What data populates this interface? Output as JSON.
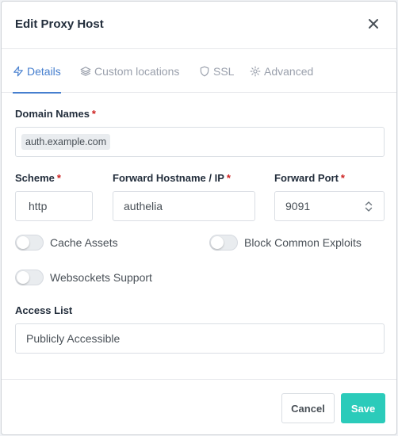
{
  "modal": {
    "title": "Edit Proxy Host"
  },
  "tabs": [
    {
      "label": "Details",
      "icon": "bolt-icon",
      "active": true
    },
    {
      "label": "Custom locations",
      "icon": "layers-icon",
      "active": false
    },
    {
      "label": "SSL",
      "icon": "shield-icon",
      "active": false
    },
    {
      "label": "Advanced",
      "icon": "gear-icon",
      "active": false
    }
  ],
  "form": {
    "domain_names": {
      "label": "Domain Names",
      "required_mark": "*",
      "tags": [
        "auth.example.com"
      ]
    },
    "scheme": {
      "label": "Scheme",
      "required_mark": "*",
      "value": "http"
    },
    "forward_hostname": {
      "label": "Forward Hostname / IP",
      "required_mark": "*",
      "value": "authelia"
    },
    "forward_port": {
      "label": "Forward Port",
      "required_mark": "*",
      "value": "9091"
    },
    "toggles": {
      "cache_assets": {
        "label": "Cache Assets",
        "on": false
      },
      "block_exploits": {
        "label": "Block Common Exploits",
        "on": false
      },
      "websockets": {
        "label": "Websockets Support",
        "on": false
      }
    },
    "access_list": {
      "label": "Access List",
      "value": "Publicly Accessible"
    }
  },
  "footer": {
    "cancel_label": "Cancel",
    "save_label": "Save"
  },
  "colors": {
    "accent": "#467fcf",
    "save": "#2bcbba",
    "required": "#cd201f"
  }
}
